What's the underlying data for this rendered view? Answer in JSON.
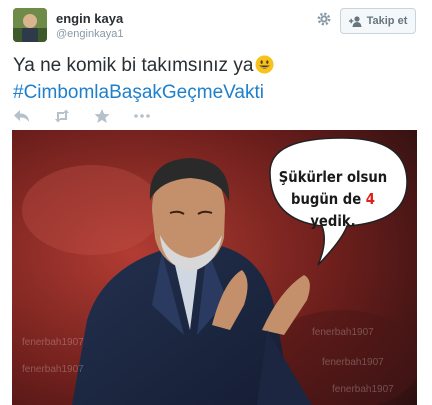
{
  "tweet": {
    "author_name": "engin kaya",
    "author_handle": "@enginkaya1",
    "follow_label": "Takip et",
    "text": "Ya ne komik bi takımsınız ya",
    "emoji": "smiling-face-emoji",
    "hashtag": "#CimbomlaBaşakGeçmeVakti"
  },
  "actions": [
    {
      "name": "reply-icon"
    },
    {
      "name": "retweet-icon"
    },
    {
      "name": "favorite-icon"
    },
    {
      "name": "more-icon"
    }
  ],
  "image": {
    "bubble_line1": "Şükürler olsun",
    "bubble_line2_pre": "bugün de ",
    "bubble_line2_num": "4",
    "bubble_line2_post": " yedik.",
    "watermark": "fenerbah1907"
  },
  "colors": {
    "link": "#1e7fcc",
    "name": "#292f33",
    "handle": "#8899a6",
    "highlight": "#e0201a"
  }
}
